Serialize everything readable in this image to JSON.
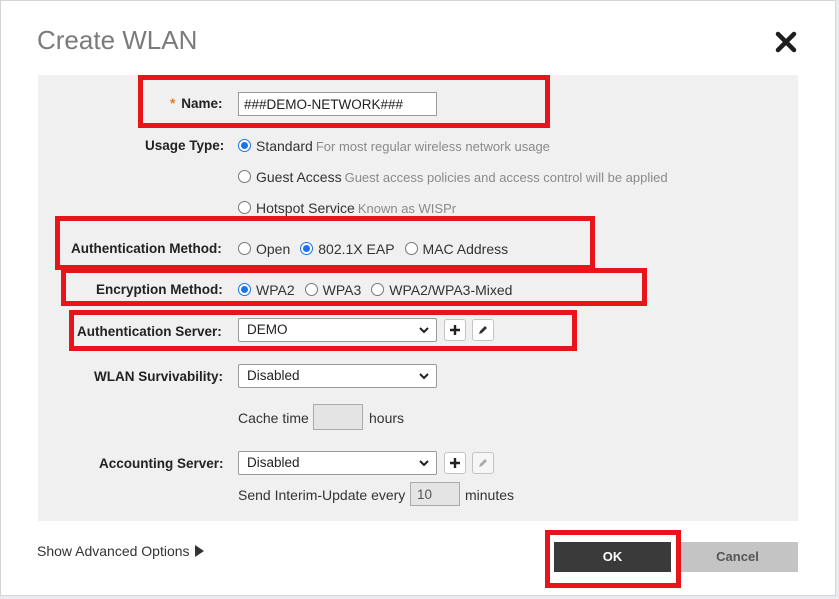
{
  "dialog": {
    "title": "Create WLAN",
    "close_icon": "close-x-icon"
  },
  "fields": {
    "name": {
      "required_mark": "*",
      "label": "Name:",
      "value": "###DEMO-NETWORK###"
    },
    "usage_type": {
      "label": "Usage Type:",
      "options": [
        {
          "label": "Standard",
          "hint": "For most regular wireless network usage",
          "checked": true
        },
        {
          "label": "Guest Access",
          "hint": "Guest access policies and access control will be applied",
          "checked": false
        },
        {
          "label": "Hotspot Service",
          "hint": "Known as WISPr",
          "checked": false
        }
      ]
    },
    "auth_method": {
      "label": "Authentication Method:",
      "options": [
        {
          "label": "Open",
          "checked": false
        },
        {
          "label": "802.1X EAP",
          "checked": true
        },
        {
          "label": "MAC Address",
          "checked": false
        }
      ]
    },
    "encryption_method": {
      "label": "Encryption Method:",
      "options": [
        {
          "label": "WPA2",
          "checked": true
        },
        {
          "label": "WPA3",
          "checked": false
        },
        {
          "label": "WPA2/WPA3-Mixed",
          "checked": false
        }
      ]
    },
    "auth_server": {
      "label": "Authentication Server:",
      "value": "DEMO"
    },
    "wlan_survivability": {
      "label": "WLAN Survivability:",
      "value": "Disabled",
      "cache_time_label": "Cache time",
      "cache_time_value": "",
      "cache_time_unit": "hours"
    },
    "accounting_server": {
      "label": "Accounting Server:",
      "value": "Disabled",
      "interim_label": "Send Interim-Update every",
      "interim_value": "10",
      "interim_unit": "minutes"
    }
  },
  "footer": {
    "advanced_options": "Show Advanced Options",
    "ok_label": "OK",
    "cancel_label": "Cancel"
  },
  "colors": {
    "highlight_box": "#e8141c",
    "radio_accent": "#1a73e8",
    "ok_button_bg": "#3a3a3a",
    "cancel_button_bg": "#c4c4c4",
    "form_bg": "#f0f0f0"
  }
}
